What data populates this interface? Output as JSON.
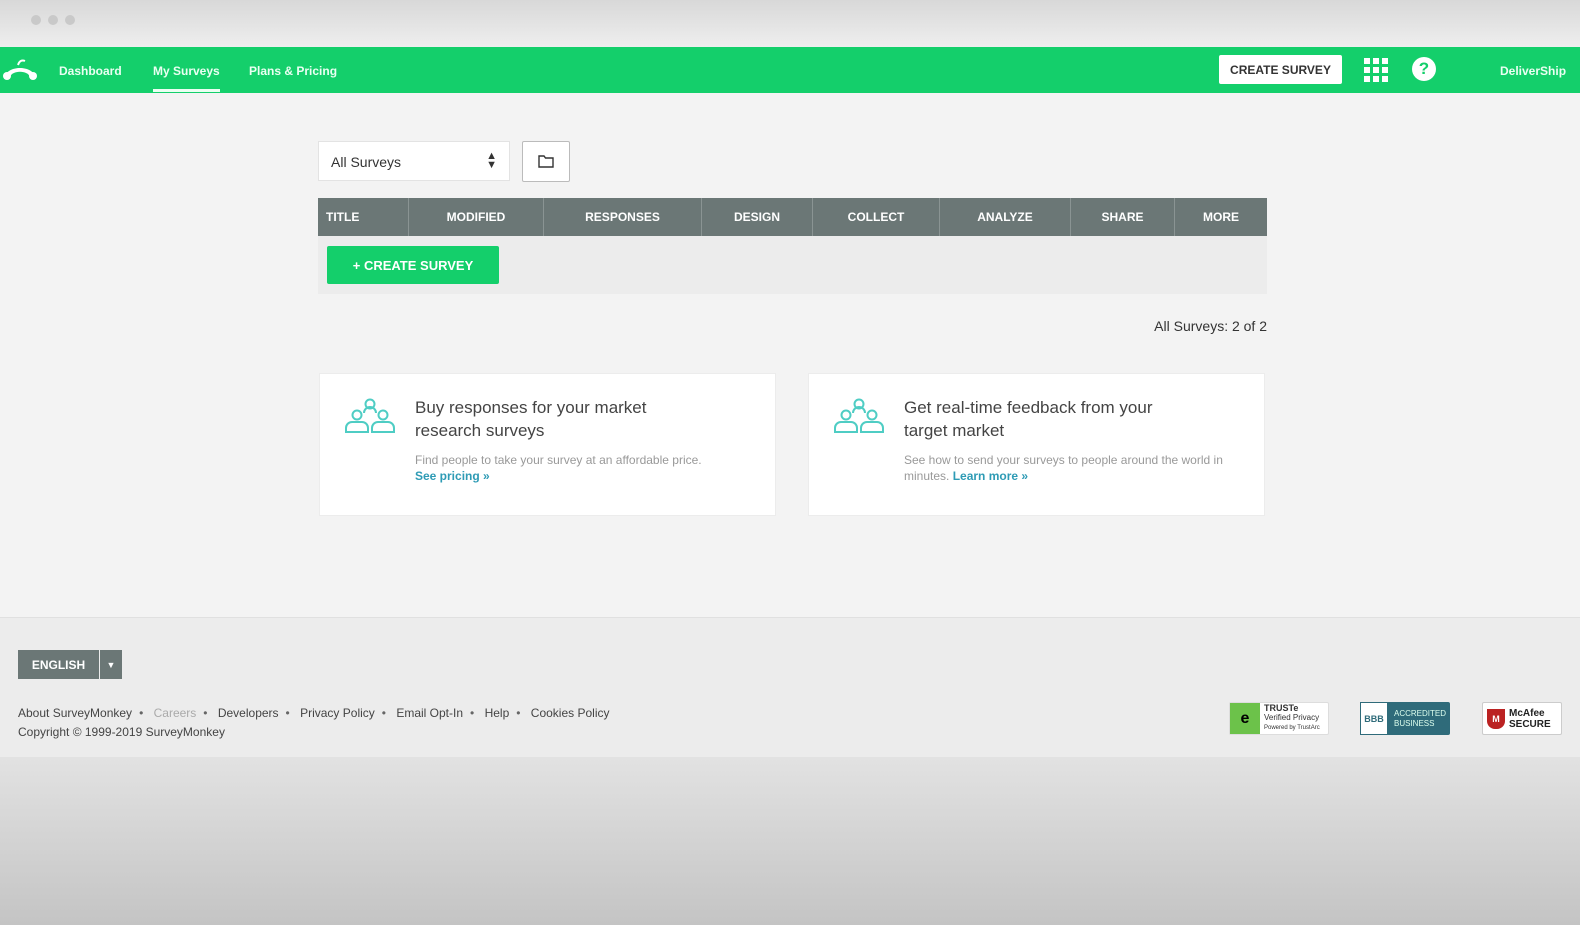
{
  "nav": {
    "items": [
      "Dashboard",
      "My Surveys",
      "Plans & Pricing"
    ],
    "create_label": "CREATE SURVEY",
    "account": "DeliverShip"
  },
  "filter": {
    "selected": "All Surveys"
  },
  "table": {
    "columns": [
      "TITLE",
      "MODIFIED",
      "RESPONSES",
      "DESIGN",
      "COLLECT",
      "ANALYZE",
      "SHARE",
      "MORE"
    ],
    "create_label": "+ CREATE SURVEY"
  },
  "count": "All Surveys: 2 of 2",
  "cards": [
    {
      "title": "Buy responses for your market research surveys",
      "desc": "Find people to take your survey at an affordable price.",
      "link": "See pricing »"
    },
    {
      "title": "Get real-time feedback from your target market",
      "desc": "See how to send your surveys to people around the world in minutes.",
      "link": "Learn more »"
    }
  ],
  "footer": {
    "language": "ENGLISH",
    "links": [
      "About SurveyMonkey",
      "Careers",
      "Developers",
      "Privacy Policy",
      "Email Opt-In",
      "Help",
      "Cookies Policy"
    ],
    "copyright": "Copyright © 1999-2019 SurveyMonkey",
    "badges": {
      "truste": "TRUSTe",
      "truste_sub": "Verified Privacy",
      "truste_pow": "Powered by TrustArc",
      "bbb": "ACCREDITED BUSINESS",
      "mcafee": "McAfee SECURE"
    }
  },
  "colors": {
    "brand": "#14cf6b",
    "header": "#6b7776",
    "link": "#2e9bb5"
  }
}
